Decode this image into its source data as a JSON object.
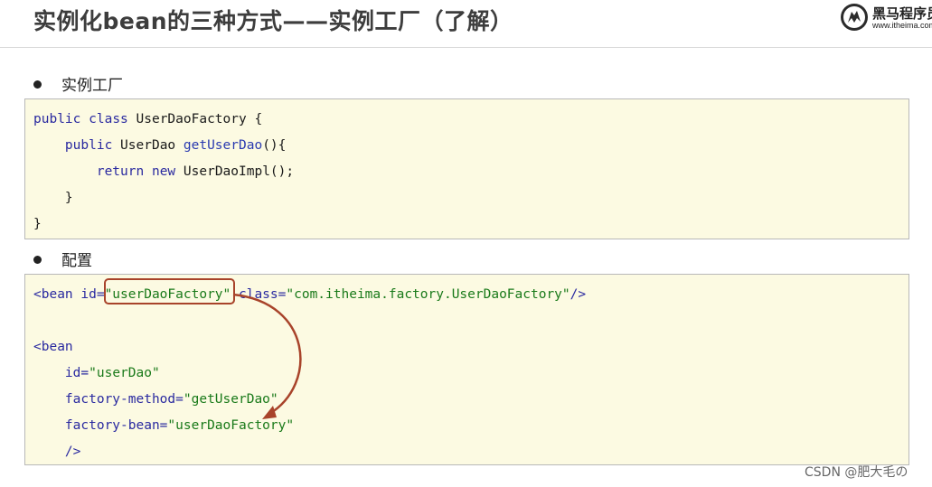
{
  "slide": {
    "title": "实例化bean的三种方式——实例工厂（了解）",
    "logo": {
      "name": "黑马程序员",
      "url": "www.itheima.com"
    },
    "watermark": "CSDN @肥大毛の"
  },
  "section1": {
    "bullet": "实例工厂",
    "code": {
      "line1": {
        "kw1": "public",
        "kw2": "class",
        "name": " UserDaoFactory {"
      },
      "line2": {
        "indent": "    ",
        "kw1": "public",
        "type": " UserDao ",
        "fn": "getUserDao",
        "rest": "(){"
      },
      "line3": {
        "indent": "        ",
        "kw1": "return",
        "kw2": "new",
        "rest": " UserDaoImpl();"
      },
      "line4": "    }",
      "line5": "}"
    }
  },
  "section2": {
    "bullet": "配置",
    "code": {
      "line1": {
        "tag": "<bean",
        "attr1": " id=",
        "val1": "\"userDaoFactory\"",
        "attr2": " class=",
        "val2": "\"com.itheima.factory.UserDaoFactory\"",
        "end": "/>"
      },
      "line2": {
        "tag": "<bean"
      },
      "line3": {
        "indent": "    ",
        "attr": "id=",
        "val": "\"userDao\""
      },
      "line4": {
        "indent": "    ",
        "attr": "factory-method=",
        "val": "\"getUserDao\""
      },
      "line5": {
        "indent": "    ",
        "attr": "factory-bean=",
        "val": "\"userDaoFactory\""
      },
      "line6": {
        "indent": "    ",
        "end": "/>"
      }
    }
  },
  "colors": {
    "code_bg": "#fcfae2",
    "keyword": "#2a2aa0",
    "string": "#1a7a1a",
    "highlight": "#a8432a"
  }
}
